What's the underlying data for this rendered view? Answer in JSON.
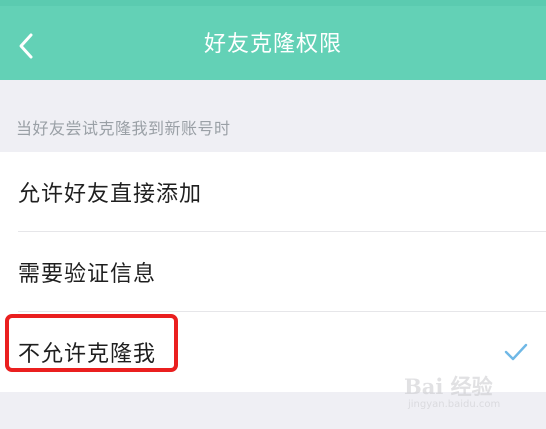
{
  "header": {
    "title": "好友克隆权限",
    "back_icon": "chevron-left-icon",
    "background_color": "#63d1b6"
  },
  "section": {
    "header": "当好友尝试克隆我到新账号时"
  },
  "options": [
    {
      "label": "允许好友直接添加",
      "selected": false
    },
    {
      "label": "需要验证信息",
      "selected": false
    },
    {
      "label": "不允许克隆我",
      "selected": true
    }
  ],
  "selected_indicator": {
    "icon": "checkmark-icon",
    "color": "#6fb8e6"
  },
  "annotation": {
    "highlight_color": "#ea1f1f"
  },
  "watermark": {
    "main": "Bai 经验",
    "sub": "jingyan.baidu.com"
  }
}
